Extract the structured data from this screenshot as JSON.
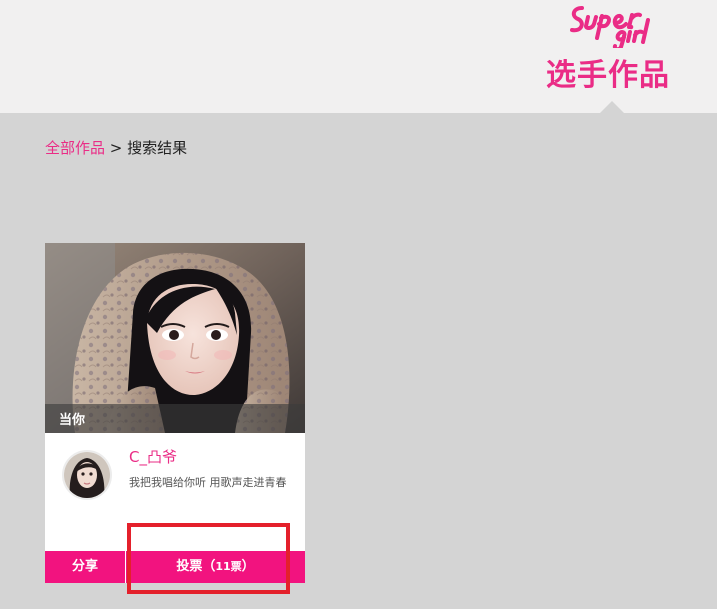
{
  "header": {
    "logo_text": "Super girl",
    "title": "选手作品",
    "accent_color": "#ea2c86"
  },
  "breadcrumb": {
    "link_label": "全部作品",
    "separator": ">",
    "current": "搜索结果"
  },
  "card": {
    "work_title": "当你",
    "username": "C_凸爷",
    "description": "我把我唱给你听 用歌声走进青春",
    "share_label": "分享",
    "vote_label": "投票（",
    "vote_count": "11票",
    "vote_suffix": "）",
    "button_color": "#f2137f"
  },
  "annotation": {
    "highlight_color": "#e4202b"
  }
}
